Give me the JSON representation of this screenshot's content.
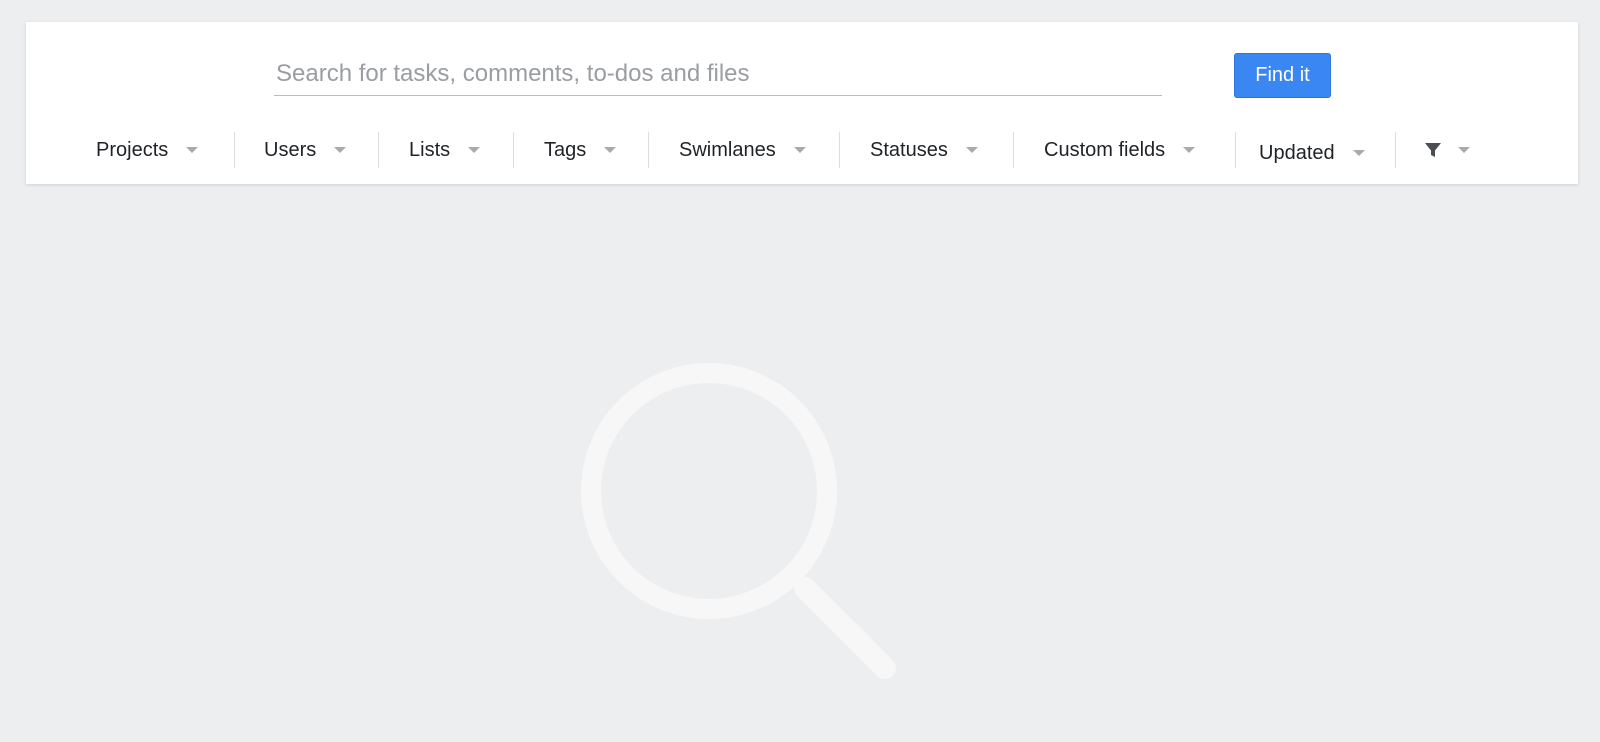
{
  "search": {
    "placeholder": "Search for tasks, comments, to-dos and files",
    "value": "",
    "button_label": "Find it"
  },
  "filters": [
    {
      "label": "Projects"
    },
    {
      "label": "Users"
    },
    {
      "label": "Lists"
    },
    {
      "label": "Tags"
    },
    {
      "label": "Swimlanes"
    },
    {
      "label": "Statuses"
    },
    {
      "label": "Custom fields"
    },
    {
      "label": "Updated"
    }
  ],
  "icons": {
    "filter": "funnel-icon",
    "caret": "caret-down-icon",
    "empty_state": "search-icon"
  },
  "colors": {
    "accent": "#3a86f2",
    "background": "#edeef0",
    "panel": "#ffffff",
    "muted_icon": "#f7f7f8"
  }
}
